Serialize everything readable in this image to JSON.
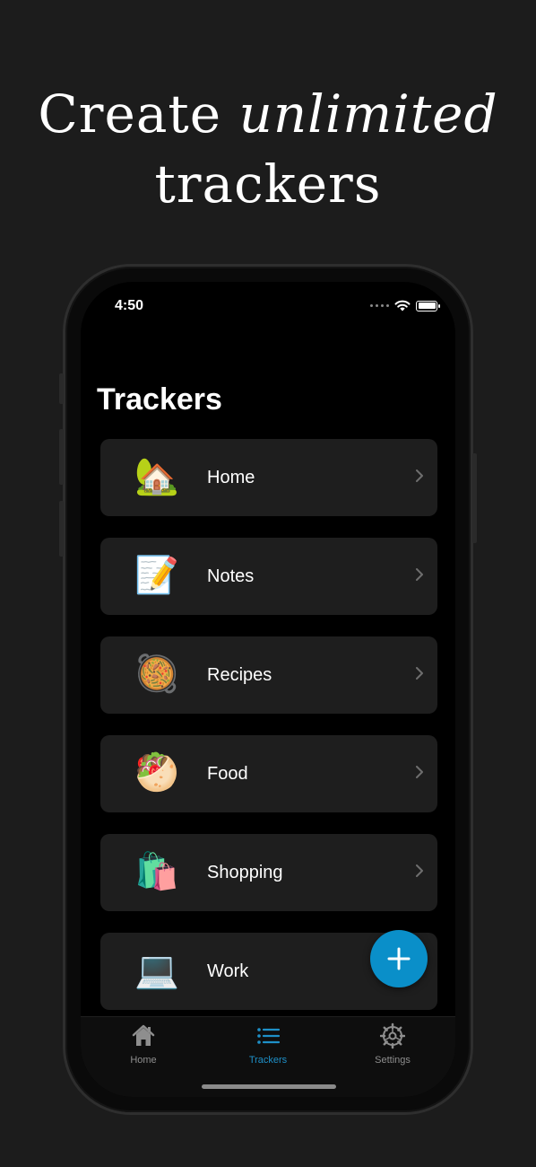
{
  "headline": {
    "line1_plain": "Create ",
    "line1_italic": "unlimited",
    "line2": "trackers"
  },
  "status_bar": {
    "time": "4:50"
  },
  "page_title": "Trackers",
  "trackers": [
    {
      "emoji": "🏡",
      "label": "Home"
    },
    {
      "emoji": "📝",
      "label": "Notes"
    },
    {
      "emoji": "🥘",
      "label": "Recipes"
    },
    {
      "emoji": "🥙",
      "label": "Food"
    },
    {
      "emoji": "🛍️",
      "label": "Shopping"
    },
    {
      "emoji": "💻",
      "label": "Work"
    }
  ],
  "fab": {
    "icon": "plus-icon",
    "color": "#0a8fc9"
  },
  "tabs": [
    {
      "label": "Home",
      "icon": "house-icon"
    },
    {
      "label": "Trackers",
      "icon": "list-icon",
      "active": true
    },
    {
      "label": "Settings",
      "icon": "gear-icon"
    }
  ],
  "colors": {
    "accent": "#1e90c8",
    "background": "#1c1c1c",
    "row": "#1e1e1e"
  }
}
